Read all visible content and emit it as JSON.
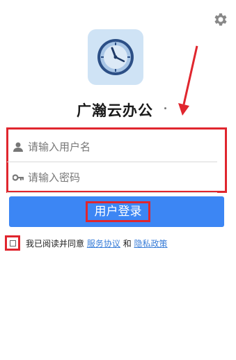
{
  "header": {
    "settings_icon": "gear-icon"
  },
  "app": {
    "name": "广瀚云办公",
    "logo_icon": "clock-logo-icon"
  },
  "form": {
    "username": {
      "placeholder": "请输入用户名",
      "value": "",
      "icon": "user-icon"
    },
    "password": {
      "placeholder": "请输入密码",
      "value": "",
      "icon": "key-icon"
    }
  },
  "login_button": {
    "label": "用户登录"
  },
  "agreement": {
    "checked": false,
    "prefix": "我已阅读并同意",
    "service_link": "服务协议",
    "conjunction": "和",
    "privacy_link": "隐私政策"
  },
  "colors": {
    "accent": "#3c86f4",
    "highlight": "#e0262e",
    "link": "#3a7ed8"
  }
}
